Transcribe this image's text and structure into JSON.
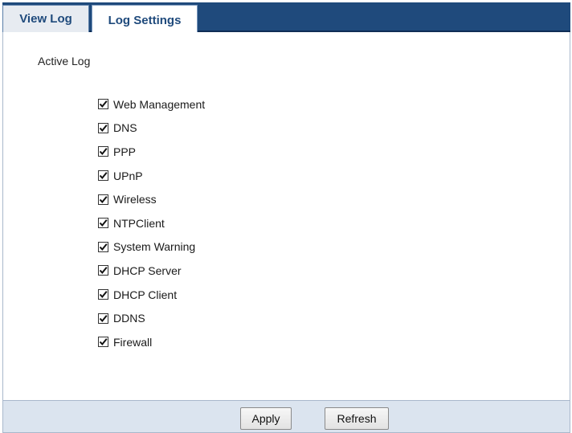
{
  "tabs": [
    {
      "label": "View Log",
      "active": false
    },
    {
      "label": "Log Settings",
      "active": true
    }
  ],
  "section": {
    "title": "Active Log"
  },
  "log_items": [
    {
      "label": "Web Management",
      "checked": true
    },
    {
      "label": "DNS",
      "checked": true
    },
    {
      "label": "PPP",
      "checked": true
    },
    {
      "label": "UPnP",
      "checked": true
    },
    {
      "label": "Wireless",
      "checked": true
    },
    {
      "label": "NTPClient",
      "checked": true
    },
    {
      "label": "System Warning",
      "checked": true
    },
    {
      "label": "DHCP Server",
      "checked": true
    },
    {
      "label": "DHCP Client",
      "checked": true
    },
    {
      "label": "DDNS",
      "checked": true
    },
    {
      "label": "Firewall",
      "checked": true
    }
  ],
  "buttons": {
    "apply_label": "Apply",
    "refresh_label": "Refresh"
  },
  "colors": {
    "tabbar": "#1f4a7c",
    "tab_text": "#1f4a7c",
    "footer": "#dbe4ef"
  },
  "icons": {
    "checkbox_mark": "check-icon"
  }
}
